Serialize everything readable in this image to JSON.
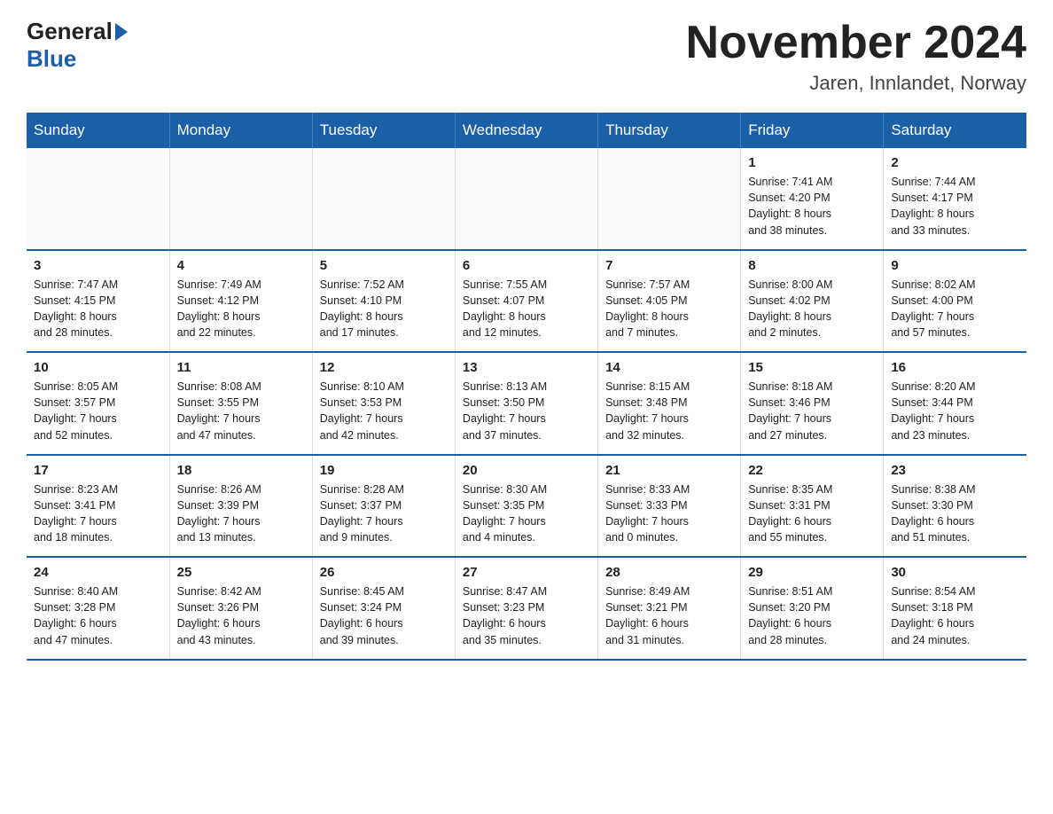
{
  "header": {
    "logo_general": "General",
    "logo_blue": "Blue",
    "month_title": "November 2024",
    "location": "Jaren, Innlandet, Norway"
  },
  "weekdays": [
    "Sunday",
    "Monday",
    "Tuesday",
    "Wednesday",
    "Thursday",
    "Friday",
    "Saturday"
  ],
  "weeks": [
    [
      {
        "day": "",
        "info": ""
      },
      {
        "day": "",
        "info": ""
      },
      {
        "day": "",
        "info": ""
      },
      {
        "day": "",
        "info": ""
      },
      {
        "day": "",
        "info": ""
      },
      {
        "day": "1",
        "info": "Sunrise: 7:41 AM\nSunset: 4:20 PM\nDaylight: 8 hours\nand 38 minutes."
      },
      {
        "day": "2",
        "info": "Sunrise: 7:44 AM\nSunset: 4:17 PM\nDaylight: 8 hours\nand 33 minutes."
      }
    ],
    [
      {
        "day": "3",
        "info": "Sunrise: 7:47 AM\nSunset: 4:15 PM\nDaylight: 8 hours\nand 28 minutes."
      },
      {
        "day": "4",
        "info": "Sunrise: 7:49 AM\nSunset: 4:12 PM\nDaylight: 8 hours\nand 22 minutes."
      },
      {
        "day": "5",
        "info": "Sunrise: 7:52 AM\nSunset: 4:10 PM\nDaylight: 8 hours\nand 17 minutes."
      },
      {
        "day": "6",
        "info": "Sunrise: 7:55 AM\nSunset: 4:07 PM\nDaylight: 8 hours\nand 12 minutes."
      },
      {
        "day": "7",
        "info": "Sunrise: 7:57 AM\nSunset: 4:05 PM\nDaylight: 8 hours\nand 7 minutes."
      },
      {
        "day": "8",
        "info": "Sunrise: 8:00 AM\nSunset: 4:02 PM\nDaylight: 8 hours\nand 2 minutes."
      },
      {
        "day": "9",
        "info": "Sunrise: 8:02 AM\nSunset: 4:00 PM\nDaylight: 7 hours\nand 57 minutes."
      }
    ],
    [
      {
        "day": "10",
        "info": "Sunrise: 8:05 AM\nSunset: 3:57 PM\nDaylight: 7 hours\nand 52 minutes."
      },
      {
        "day": "11",
        "info": "Sunrise: 8:08 AM\nSunset: 3:55 PM\nDaylight: 7 hours\nand 47 minutes."
      },
      {
        "day": "12",
        "info": "Sunrise: 8:10 AM\nSunset: 3:53 PM\nDaylight: 7 hours\nand 42 minutes."
      },
      {
        "day": "13",
        "info": "Sunrise: 8:13 AM\nSunset: 3:50 PM\nDaylight: 7 hours\nand 37 minutes."
      },
      {
        "day": "14",
        "info": "Sunrise: 8:15 AM\nSunset: 3:48 PM\nDaylight: 7 hours\nand 32 minutes."
      },
      {
        "day": "15",
        "info": "Sunrise: 8:18 AM\nSunset: 3:46 PM\nDaylight: 7 hours\nand 27 minutes."
      },
      {
        "day": "16",
        "info": "Sunrise: 8:20 AM\nSunset: 3:44 PM\nDaylight: 7 hours\nand 23 minutes."
      }
    ],
    [
      {
        "day": "17",
        "info": "Sunrise: 8:23 AM\nSunset: 3:41 PM\nDaylight: 7 hours\nand 18 minutes."
      },
      {
        "day": "18",
        "info": "Sunrise: 8:26 AM\nSunset: 3:39 PM\nDaylight: 7 hours\nand 13 minutes."
      },
      {
        "day": "19",
        "info": "Sunrise: 8:28 AM\nSunset: 3:37 PM\nDaylight: 7 hours\nand 9 minutes."
      },
      {
        "day": "20",
        "info": "Sunrise: 8:30 AM\nSunset: 3:35 PM\nDaylight: 7 hours\nand 4 minutes."
      },
      {
        "day": "21",
        "info": "Sunrise: 8:33 AM\nSunset: 3:33 PM\nDaylight: 7 hours\nand 0 minutes."
      },
      {
        "day": "22",
        "info": "Sunrise: 8:35 AM\nSunset: 3:31 PM\nDaylight: 6 hours\nand 55 minutes."
      },
      {
        "day": "23",
        "info": "Sunrise: 8:38 AM\nSunset: 3:30 PM\nDaylight: 6 hours\nand 51 minutes."
      }
    ],
    [
      {
        "day": "24",
        "info": "Sunrise: 8:40 AM\nSunset: 3:28 PM\nDaylight: 6 hours\nand 47 minutes."
      },
      {
        "day": "25",
        "info": "Sunrise: 8:42 AM\nSunset: 3:26 PM\nDaylight: 6 hours\nand 43 minutes."
      },
      {
        "day": "26",
        "info": "Sunrise: 8:45 AM\nSunset: 3:24 PM\nDaylight: 6 hours\nand 39 minutes."
      },
      {
        "day": "27",
        "info": "Sunrise: 8:47 AM\nSunset: 3:23 PM\nDaylight: 6 hours\nand 35 minutes."
      },
      {
        "day": "28",
        "info": "Sunrise: 8:49 AM\nSunset: 3:21 PM\nDaylight: 6 hours\nand 31 minutes."
      },
      {
        "day": "29",
        "info": "Sunrise: 8:51 AM\nSunset: 3:20 PM\nDaylight: 6 hours\nand 28 minutes."
      },
      {
        "day": "30",
        "info": "Sunrise: 8:54 AM\nSunset: 3:18 PM\nDaylight: 6 hours\nand 24 minutes."
      }
    ]
  ]
}
